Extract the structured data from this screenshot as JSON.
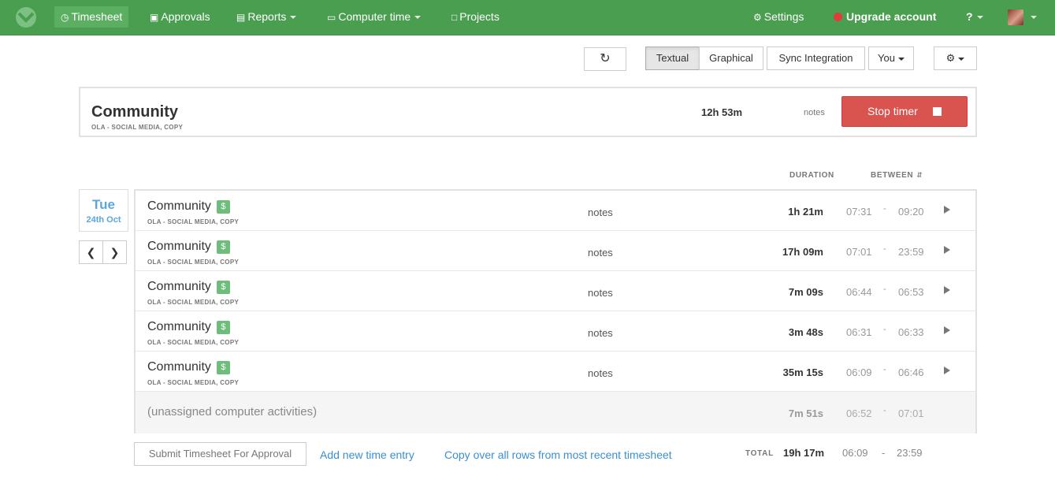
{
  "nav": {
    "timesheet": "Timesheet",
    "approvals": "Approvals",
    "reports": "Reports",
    "computer_time": "Computer time",
    "projects": "Projects",
    "settings": "Settings",
    "upgrade": "Upgrade account",
    "help": "?"
  },
  "toolbar": {
    "refresh_icon": "refresh-icon",
    "textual": "Textual",
    "graphical": "Graphical",
    "sync": "Sync Integration",
    "user": "You"
  },
  "timer": {
    "project": "Community",
    "subtitle": "OLA - SOCIAL MEDIA, COPY",
    "duration": "12h 53m",
    "notes": "notes",
    "stop_label": "Stop timer"
  },
  "columns": {
    "duration": "DURATION",
    "between": "BETWEEN"
  },
  "day": {
    "name": "Tue",
    "date": "24th Oct"
  },
  "entries": [
    {
      "project": "Community",
      "billable": "$",
      "subtitle": "OLA - SOCIAL MEDIA, COPY",
      "notes": "notes",
      "duration": "1h 21m",
      "start": "07:31",
      "end": "09:20"
    },
    {
      "project": "Community",
      "billable": "$",
      "subtitle": "OLA - SOCIAL MEDIA, COPY",
      "notes": "notes",
      "duration": "17h 09m",
      "start": "07:01",
      "end": "23:59"
    },
    {
      "project": "Community",
      "billable": "$",
      "subtitle": "OLA - SOCIAL MEDIA, COPY",
      "notes": "notes",
      "duration": "7m 09s",
      "start": "06:44",
      "end": "06:53"
    },
    {
      "project": "Community",
      "billable": "$",
      "subtitle": "OLA - SOCIAL MEDIA, COPY",
      "notes": "notes",
      "duration": "3m 48s",
      "start": "06:31",
      "end": "06:33"
    },
    {
      "project": "Community",
      "billable": "$",
      "subtitle": "OLA - SOCIAL MEDIA, COPY",
      "notes": "notes",
      "duration": "35m 15s",
      "start": "06:09",
      "end": "06:46"
    }
  ],
  "unassigned": {
    "label": "(unassigned computer activities)",
    "duration": "7m 51s",
    "start": "06:52",
    "end": "07:01"
  },
  "footer": {
    "submit": "Submit Timesheet For Approval",
    "add_entry": "Add new time entry",
    "copy_rows": "Copy over all rows from most recent timesheet",
    "total_label": "TOTAL",
    "total_value": "19h 17m",
    "total_start": "06:09",
    "total_sep": "-",
    "total_end": "23:59"
  },
  "colors": {
    "header_green": "#4a9e50",
    "stop_red": "#d9534f",
    "link_blue": "#3a8fd4",
    "billable_green": "#6dbd7b"
  }
}
